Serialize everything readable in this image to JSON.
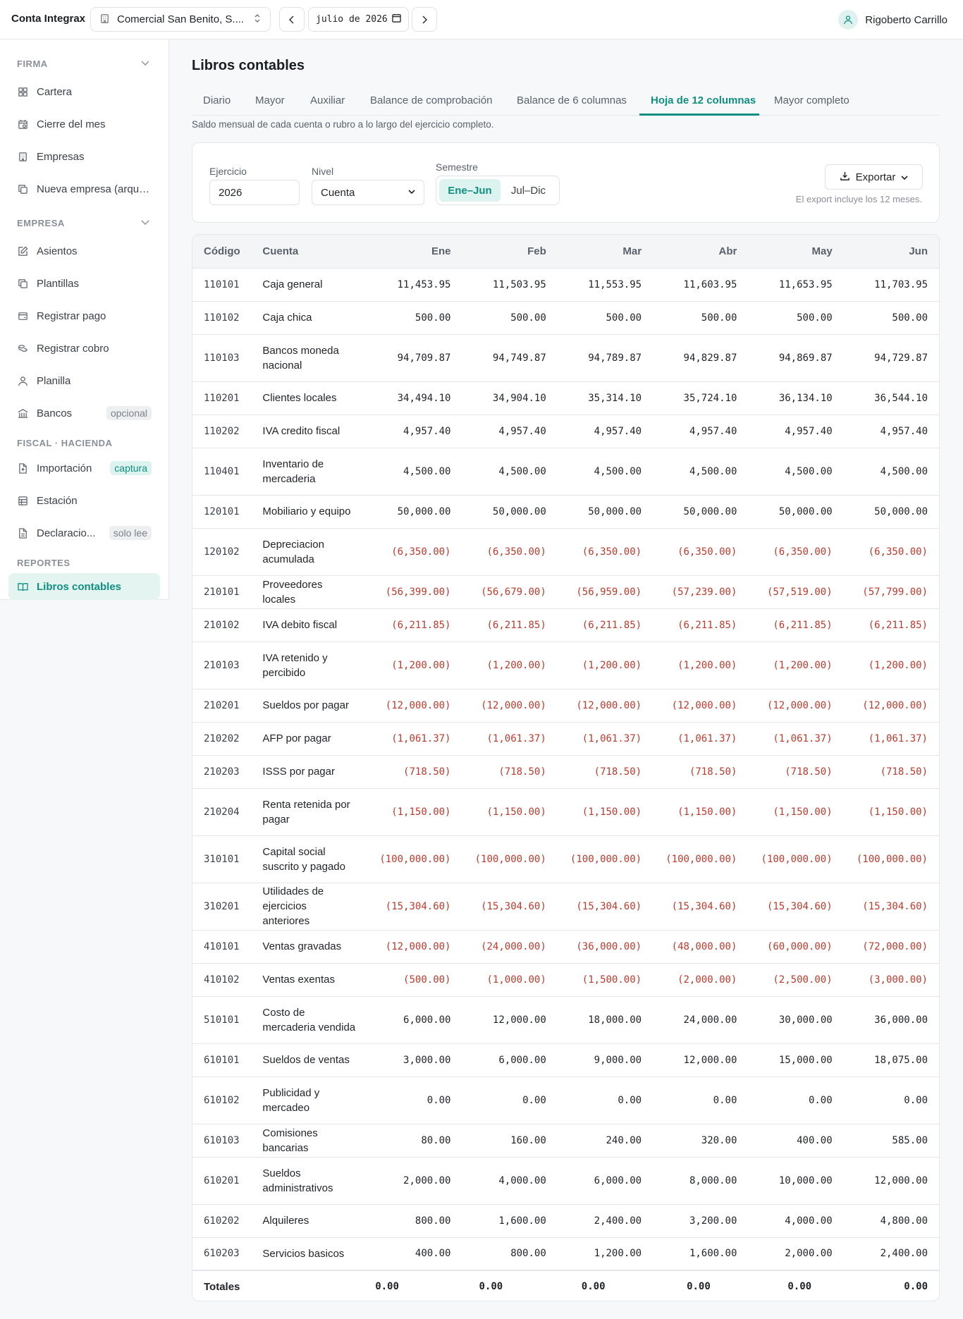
{
  "topbar": {
    "brand": "Conta Integrax",
    "company": "Comercial San Benito, S....",
    "month": "julio de 2026",
    "user_name": "Rigoberto Carrillo"
  },
  "sidebar": {
    "sections": {
      "firma": "FIRMA",
      "empresa": "EMPRESA",
      "fiscal": "FISCAL · HACIENDA",
      "reportes": "REPORTES"
    },
    "items": [
      {
        "label": "Cartera"
      },
      {
        "label": "Cierre del mes"
      },
      {
        "label": "Empresas"
      },
      {
        "label": "Nueva empresa (arqueti..."
      },
      {
        "label": "Asientos"
      },
      {
        "label": "Plantillas"
      },
      {
        "label": "Registrar pago"
      },
      {
        "label": "Registrar cobro"
      },
      {
        "label": "Planilla"
      },
      {
        "label": "Bancos",
        "badge": "opcional"
      },
      {
        "label": "Importación",
        "badge": "captura"
      },
      {
        "label": "Estación"
      },
      {
        "label": "Declaracio...",
        "badge": "solo lee"
      },
      {
        "label": "Libros contables"
      }
    ]
  },
  "main": {
    "title": "Libros contables",
    "tabs": [
      {
        "label": "Diario"
      },
      {
        "label": "Mayor"
      },
      {
        "label": "Auxiliar"
      },
      {
        "label": "Balance de comprobación"
      },
      {
        "label": "Balance de 6 columnas"
      },
      {
        "label": "Hoja de 12 columnas",
        "active": true
      },
      {
        "label": "Mayor completo"
      }
    ],
    "subtitle": "Saldo mensual de cada cuenta o rubro a lo largo del ejercicio completo."
  },
  "filters": {
    "ejercicio_label": "Ejercicio",
    "ejercicio_value": "2026",
    "nivel_label": "Nivel",
    "nivel_value": "Cuenta",
    "semestre_label": "Semestre",
    "semestre_options": [
      "Ene–Jun",
      "Jul–Dic"
    ],
    "semestre_selected": "Ene–Jun",
    "export_label": "Exportar",
    "export_note": "El export incluye los 12 meses."
  },
  "table": {
    "headers": {
      "code": "Código",
      "account": "Cuenta",
      "months": [
        "Ene",
        "Feb",
        "Mar",
        "Abr",
        "May",
        "Jun"
      ]
    },
    "rows": [
      {
        "code": "110101",
        "account": "Caja general",
        "values": [
          "11,453.95",
          "11,503.95",
          "11,553.95",
          "11,603.95",
          "11,653.95",
          "11,703.95"
        ]
      },
      {
        "code": "110102",
        "account": "Caja chica",
        "values": [
          "500.00",
          "500.00",
          "500.00",
          "500.00",
          "500.00",
          "500.00"
        ]
      },
      {
        "code": "110103",
        "account": "Bancos moneda nacional",
        "values": [
          "94,709.87",
          "94,749.87",
          "94,789.87",
          "94,829.87",
          "94,869.87",
          "94,729.87"
        ]
      },
      {
        "code": "110201",
        "account": "Clientes locales",
        "values": [
          "34,494.10",
          "34,904.10",
          "35,314.10",
          "35,724.10",
          "36,134.10",
          "36,544.10"
        ]
      },
      {
        "code": "110202",
        "account": "IVA credito fiscal",
        "values": [
          "4,957.40",
          "4,957.40",
          "4,957.40",
          "4,957.40",
          "4,957.40",
          "4,957.40"
        ]
      },
      {
        "code": "110401",
        "account": "Inventario de mercaderia",
        "values": [
          "4,500.00",
          "4,500.00",
          "4,500.00",
          "4,500.00",
          "4,500.00",
          "4,500.00"
        ]
      },
      {
        "code": "120101",
        "account": "Mobiliario y equipo",
        "values": [
          "50,000.00",
          "50,000.00",
          "50,000.00",
          "50,000.00",
          "50,000.00",
          "50,000.00"
        ]
      },
      {
        "code": "120102",
        "account": "Depreciacion acumulada",
        "values": [
          "(6,350.00)",
          "(6,350.00)",
          "(6,350.00)",
          "(6,350.00)",
          "(6,350.00)",
          "(6,350.00)"
        ]
      },
      {
        "code": "210101",
        "account": "Proveedores locales",
        "values": [
          "(56,399.00)",
          "(56,679.00)",
          "(56,959.00)",
          "(57,239.00)",
          "(57,519.00)",
          "(57,799.00)"
        ]
      },
      {
        "code": "210102",
        "account": "IVA debito fiscal",
        "values": [
          "(6,211.85)",
          "(6,211.85)",
          "(6,211.85)",
          "(6,211.85)",
          "(6,211.85)",
          "(6,211.85)"
        ]
      },
      {
        "code": "210103",
        "account": "IVA retenido y percibido",
        "values": [
          "(1,200.00)",
          "(1,200.00)",
          "(1,200.00)",
          "(1,200.00)",
          "(1,200.00)",
          "(1,200.00)"
        ]
      },
      {
        "code": "210201",
        "account": "Sueldos por pagar",
        "values": [
          "(12,000.00)",
          "(12,000.00)",
          "(12,000.00)",
          "(12,000.00)",
          "(12,000.00)",
          "(12,000.00)"
        ]
      },
      {
        "code": "210202",
        "account": "AFP por pagar",
        "values": [
          "(1,061.37)",
          "(1,061.37)",
          "(1,061.37)",
          "(1,061.37)",
          "(1,061.37)",
          "(1,061.37)"
        ]
      },
      {
        "code": "210203",
        "account": "ISSS por pagar",
        "values": [
          "(718.50)",
          "(718.50)",
          "(718.50)",
          "(718.50)",
          "(718.50)",
          "(718.50)"
        ]
      },
      {
        "code": "210204",
        "account": "Renta retenida por pagar",
        "values": [
          "(1,150.00)",
          "(1,150.00)",
          "(1,150.00)",
          "(1,150.00)",
          "(1,150.00)",
          "(1,150.00)"
        ]
      },
      {
        "code": "310101",
        "account": "Capital social suscrito y pagado",
        "values": [
          "(100,000.00)",
          "(100,000.00)",
          "(100,000.00)",
          "(100,000.00)",
          "(100,000.00)",
          "(100,000.00)"
        ]
      },
      {
        "code": "310201",
        "account": "Utilidades de ejercicios anteriores",
        "values": [
          "(15,304.60)",
          "(15,304.60)",
          "(15,304.60)",
          "(15,304.60)",
          "(15,304.60)",
          "(15,304.60)"
        ]
      },
      {
        "code": "410101",
        "account": "Ventas gravadas",
        "values": [
          "(12,000.00)",
          "(24,000.00)",
          "(36,000.00)",
          "(48,000.00)",
          "(60,000.00)",
          "(72,000.00)"
        ]
      },
      {
        "code": "410102",
        "account": "Ventas exentas",
        "values": [
          "(500.00)",
          "(1,000.00)",
          "(1,500.00)",
          "(2,000.00)",
          "(2,500.00)",
          "(3,000.00)"
        ]
      },
      {
        "code": "510101",
        "account": "Costo de mercaderia vendida",
        "values": [
          "6,000.00",
          "12,000.00",
          "18,000.00",
          "24,000.00",
          "30,000.00",
          "36,000.00"
        ]
      },
      {
        "code": "610101",
        "account": "Sueldos de ventas",
        "values": [
          "3,000.00",
          "6,000.00",
          "9,000.00",
          "12,000.00",
          "15,000.00",
          "18,075.00"
        ]
      },
      {
        "code": "610102",
        "account": "Publicidad y mercadeo",
        "values": [
          "0.00",
          "0.00",
          "0.00",
          "0.00",
          "0.00",
          "0.00"
        ]
      },
      {
        "code": "610103",
        "account": "Comisiones bancarias",
        "values": [
          "80.00",
          "160.00",
          "240.00",
          "320.00",
          "400.00",
          "585.00"
        ]
      },
      {
        "code": "610201",
        "account": "Sueldos administrativos",
        "values": [
          "2,000.00",
          "4,000.00",
          "6,000.00",
          "8,000.00",
          "10,000.00",
          "12,000.00"
        ]
      },
      {
        "code": "610202",
        "account": "Alquileres",
        "values": [
          "800.00",
          "1,600.00",
          "2,400.00",
          "3,200.00",
          "4,000.00",
          "4,800.00"
        ]
      },
      {
        "code": "610203",
        "account": "Servicios basicos",
        "values": [
          "400.00",
          "800.00",
          "1,200.00",
          "1,600.00",
          "2,000.00",
          "2,400.00"
        ]
      }
    ],
    "totals_label": "Totales",
    "totals": [
      "0.00",
      "0.00",
      "0.00",
      "0.00",
      "0.00",
      "0.00"
    ]
  },
  "colors": {
    "accent": "#0f8f80",
    "negative": "#c0392b"
  }
}
